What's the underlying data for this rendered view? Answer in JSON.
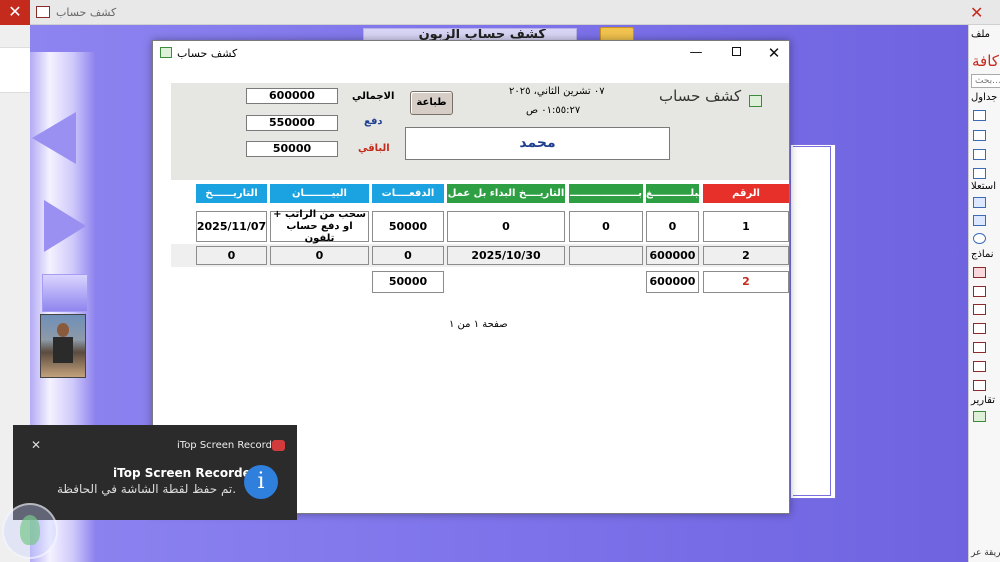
{
  "app": {
    "title": "كشف حساب",
    "close_glyph": "✕"
  },
  "background": {
    "banner_text": "كشف حساب الزبون"
  },
  "nav_pane": {
    "tab_label": "ملف",
    "title": "كافة",
    "search_placeholder": "بحث...",
    "groups": {
      "tables": "جداول",
      "queries": "استعلا",
      "forms": "نماذج",
      "reports": "تقارير"
    },
    "status": "طريقة عر"
  },
  "dialog": {
    "title": "كشف حساب",
    "min_glyph": "—",
    "close_glyph": "✕",
    "report_title": "كشف حساب",
    "print_label": "طباعة",
    "date_line": "٠٧ تشرين الثاني، ٢٠٢٥",
    "time_line": "٠١:٥٥:٢٧ ص",
    "customer_name": "محمد",
    "summary": {
      "total_label": "الاجمالي",
      "total_value": "600000",
      "paid_label": "دفع",
      "paid_value": "550000",
      "remaining_label": "الباقي",
      "remaining_value": "50000"
    },
    "columns": {
      "num": "الرقم",
      "amount": "مبلـــــــــــغ",
      "blank": "بــــــــــــــــــــ",
      "start_date": "التاريــــخ البداء بل عمل",
      "payments": "الدفعــــات",
      "statement": "البيــــــــان",
      "date": "التاريــــــخ"
    },
    "row1": {
      "num": "1",
      "amount": "0",
      "blank": "0",
      "start_date": "0",
      "payments": "50000",
      "statement": "سحب من الراتب + او دفع حساب تلفون",
      "date": "2025/11/07"
    },
    "row2": {
      "num": "2",
      "amount": "600000",
      "blank": "",
      "start_date": "2025/10/30",
      "payments": "0",
      "statement": "0",
      "date": "0"
    },
    "totals": {
      "count": "2",
      "amount": "600000",
      "payments": "50000"
    },
    "page_number": "صفحة ١ من ١"
  },
  "toast": {
    "app_name": "iTop Screen Recorder",
    "title": "iTop Screen Recorder",
    "message": "تم حفظ لقطة الشاشة في الحافظة.",
    "close_glyph": "✕",
    "info_glyph": "i"
  },
  "colors": {
    "red": "#e8302a",
    "green": "#2ea043",
    "blue": "#1aa3e0",
    "purple": "#7b6fe0"
  }
}
